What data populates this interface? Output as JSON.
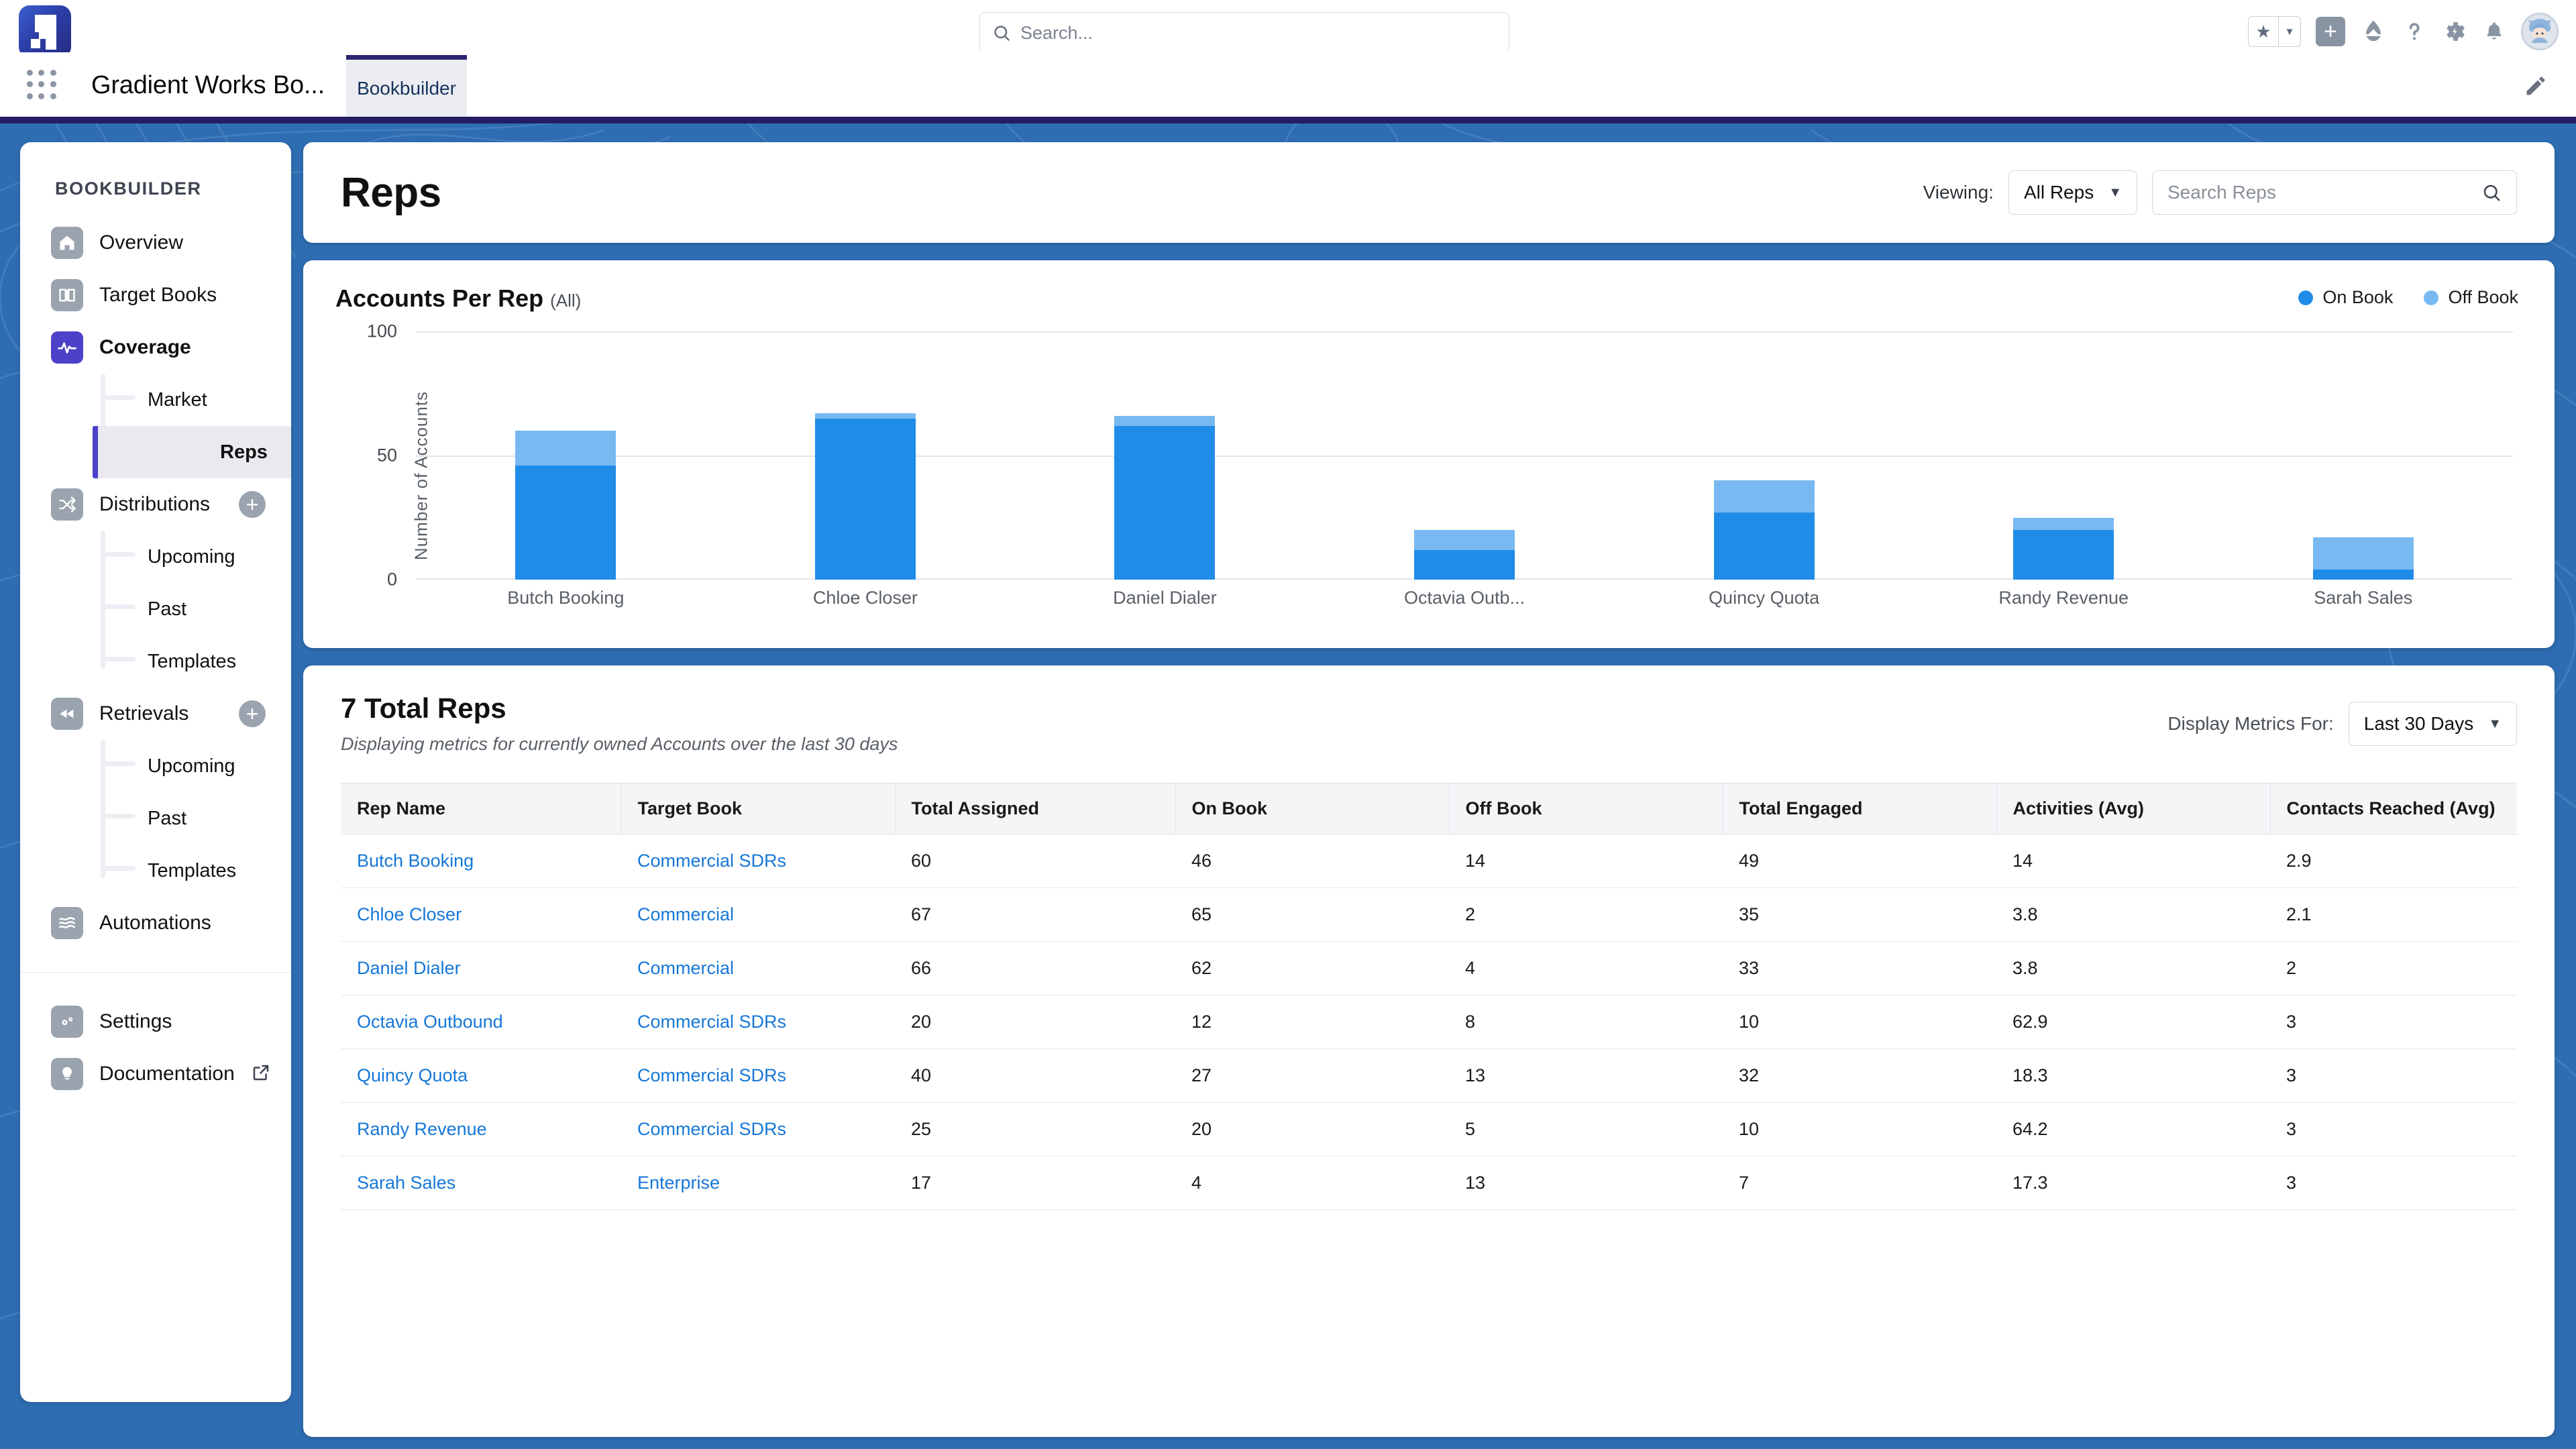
{
  "colors": {
    "brand_purple": "#4d41c9",
    "nav_bar": "#231d63",
    "bg_blue": "#2e6db1",
    "on_book": "#1f8ce8",
    "off_book": "#78b9f2",
    "link_blue": "#1677d6"
  },
  "sf_header": {
    "search_placeholder": "Search...",
    "icons": [
      "favorites-star-icon",
      "favorites-caret-icon",
      "add-icon",
      "app-launcher-drop-icon",
      "help-icon",
      "setup-gear-icon",
      "notifications-bell-icon",
      "user-avatar"
    ]
  },
  "app_nav": {
    "app_name": "Gradient Works Bo...",
    "tabs": [
      {
        "label": "Bookbuilder",
        "selected": true
      }
    ],
    "edit_label": "edit-pencil-icon"
  },
  "sidebar": {
    "title": "BOOKBUILDER",
    "items": [
      {
        "label": "Overview",
        "icon": "home-icon",
        "active": false,
        "has_plus": false
      },
      {
        "label": "Target Books",
        "icon": "book-icon",
        "active": false,
        "has_plus": false
      },
      {
        "label": "Coverage",
        "icon": "activity-icon",
        "active": true,
        "has_plus": false
      },
      {
        "label": "Distributions",
        "icon": "shuffle-icon",
        "active": false,
        "has_plus": true
      },
      {
        "label": "Retrievals",
        "icon": "rewind-icon",
        "active": false,
        "has_plus": true
      },
      {
        "label": "Automations",
        "icon": "waves-icon",
        "active": false,
        "has_plus": false
      }
    ],
    "coverage_children": [
      {
        "label": "Market",
        "selected": false
      },
      {
        "label": "Reps",
        "selected": true
      }
    ],
    "distributions_children": [
      {
        "label": "Upcoming",
        "selected": false
      },
      {
        "label": "Past",
        "selected": false
      },
      {
        "label": "Templates",
        "selected": false
      }
    ],
    "retrievals_children": [
      {
        "label": "Upcoming",
        "selected": false
      },
      {
        "label": "Past",
        "selected": false
      },
      {
        "label": "Templates",
        "selected": false
      }
    ],
    "footer_items": [
      {
        "label": "Settings",
        "icon": "gears-icon",
        "external": false
      },
      {
        "label": "Documentation",
        "icon": "lightbulb-icon",
        "external": true
      }
    ]
  },
  "page": {
    "title": "Reps",
    "viewing_label": "Viewing:",
    "viewing_value": "All Reps",
    "search_placeholder": "Search Reps"
  },
  "chart_card": {
    "title": "Accounts Per Rep",
    "title_suffix": "(All)",
    "legend": [
      {
        "label": "On Book",
        "color": "#1f8ce8"
      },
      {
        "label": "Off Book",
        "color": "#78b9f2"
      }
    ]
  },
  "chart_data": {
    "type": "bar",
    "subtype": "stacked",
    "title": "Accounts Per Rep (All)",
    "xlabel": "",
    "ylabel": "Number of Accounts",
    "ylim": [
      0,
      100
    ],
    "yticks": [
      0,
      50,
      100
    ],
    "grid": true,
    "legend_position": "top-right",
    "categories": [
      "Butch Booking",
      "Chloe Closer",
      "Daniel Dialer",
      "Octavia Outb...",
      "Quincy Quota",
      "Randy Revenue",
      "Sarah Sales"
    ],
    "series": [
      {
        "name": "On Book",
        "color": "#1f8ce8",
        "values": [
          46,
          65,
          62,
          12,
          27,
          20,
          4
        ]
      },
      {
        "name": "Off Book",
        "color": "#78b9f2",
        "values": [
          14,
          2,
          4,
          8,
          13,
          5,
          13
        ]
      }
    ],
    "totals": [
      60,
      67,
      66,
      20,
      40,
      25,
      17
    ]
  },
  "table_card": {
    "title": "7 Total Reps",
    "subtitle": "Displaying metrics for currently owned Accounts over the last 30 days",
    "metrics_label": "Display Metrics For:",
    "metrics_value": "Last 30 Days",
    "columns": [
      "Rep Name",
      "Target Book",
      "Total Assigned",
      "On Book",
      "Off Book",
      "Total Engaged",
      "Activities (Avg)",
      "Contacts Reached (Avg)"
    ],
    "rows": [
      {
        "rep": "Butch Booking",
        "book": "Commercial SDRs",
        "total_assigned": "60",
        "on_book": "46",
        "off_book": "14",
        "total_engaged": "49",
        "activities_avg": "14",
        "contacts_avg": "2.9"
      },
      {
        "rep": "Chloe Closer",
        "book": "Commercial",
        "total_assigned": "67",
        "on_book": "65",
        "off_book": "2",
        "total_engaged": "35",
        "activities_avg": "3.8",
        "contacts_avg": "2.1"
      },
      {
        "rep": "Daniel Dialer",
        "book": "Commercial",
        "total_assigned": "66",
        "on_book": "62",
        "off_book": "4",
        "total_engaged": "33",
        "activities_avg": "3.8",
        "contacts_avg": "2"
      },
      {
        "rep": "Octavia Outbound",
        "book": "Commercial SDRs",
        "total_assigned": "20",
        "on_book": "12",
        "off_book": "8",
        "total_engaged": "10",
        "activities_avg": "62.9",
        "contacts_avg": "3"
      },
      {
        "rep": "Quincy Quota",
        "book": "Commercial SDRs",
        "total_assigned": "40",
        "on_book": "27",
        "off_book": "13",
        "total_engaged": "32",
        "activities_avg": "18.3",
        "contacts_avg": "3"
      },
      {
        "rep": "Randy Revenue",
        "book": "Commercial SDRs",
        "total_assigned": "25",
        "on_book": "20",
        "off_book": "5",
        "total_engaged": "10",
        "activities_avg": "64.2",
        "contacts_avg": "3"
      },
      {
        "rep": "Sarah Sales",
        "book": "Enterprise",
        "total_assigned": "17",
        "on_book": "4",
        "off_book": "13",
        "total_engaged": "7",
        "activities_avg": "17.3",
        "contacts_avg": "3"
      }
    ]
  }
}
